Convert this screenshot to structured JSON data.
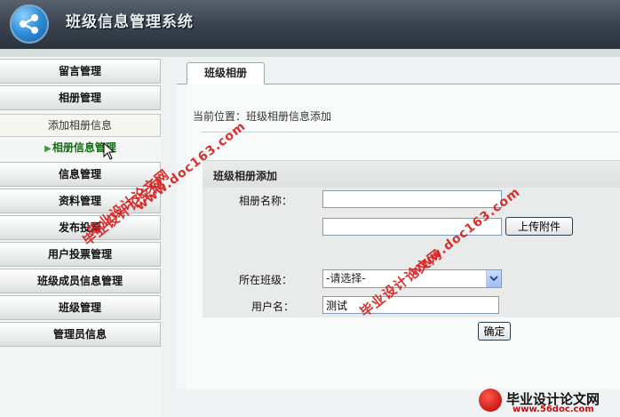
{
  "app": {
    "title": "班级信息管理系统"
  },
  "sidebar": {
    "items": [
      {
        "label": "留言管理"
      },
      {
        "label": "相册管理"
      },
      {
        "label": "信息管理"
      },
      {
        "label": "资料管理"
      },
      {
        "label": "发布投票"
      },
      {
        "label": "用户投票管理"
      },
      {
        "label": "班级成员信息管理"
      },
      {
        "label": "班级管理"
      },
      {
        "label": "管理员信息"
      }
    ],
    "submenu": {
      "add": "添加相册信息",
      "manage": "相册信息管理",
      "manage_arrow": "▶"
    }
  },
  "main": {
    "tab": "班级相册",
    "breadcrumb": "当前位置：班级相册信息添加",
    "form": {
      "title": "班级相册添加",
      "album_name_label": "相册名称：",
      "album_name_value": "",
      "upload_value": "",
      "upload_button": "上传附件",
      "class_label": "所在班级：",
      "class_selected": "-请选择-",
      "username_label": "用户名：",
      "username_value": "测试",
      "submit_button": "确定"
    }
  },
  "watermarks": {
    "text_cn": "毕业设计论文网",
    "text_url": "www.doc163.com"
  },
  "footer": {
    "brand": "毕业设计论文网",
    "url": "www.56doc.com"
  },
  "colors": {
    "header_bg": "#3a434e",
    "watermark": "#d8201e",
    "active_submenu": "#0f6d0f"
  }
}
